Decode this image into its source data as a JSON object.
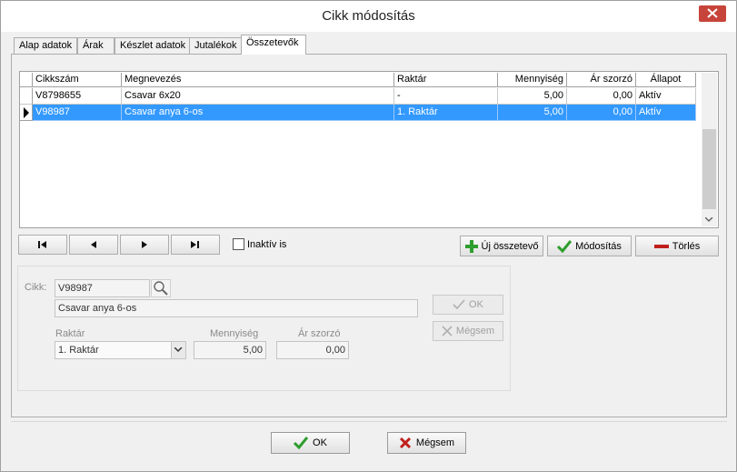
{
  "window": {
    "title": "Cikk módosítás"
  },
  "tabs": [
    {
      "label": "Alap adatok"
    },
    {
      "label": "Árak"
    },
    {
      "label": "Készlet adatok"
    },
    {
      "label": "Jutalékok"
    },
    {
      "label": "Összetevők",
      "active": true
    }
  ],
  "grid": {
    "columns": [
      "Cikkszám",
      "Megnevezés",
      "Raktár",
      "Mennyiség",
      "Ár szorzó",
      "Állapot"
    ],
    "rows": [
      {
        "cikkszam": "V8798655",
        "megnevezes": "Csavar 6x20",
        "raktar": "-",
        "mennyiseg": "5,00",
        "ar_szorzo": "0,00",
        "allapot": "Aktív"
      },
      {
        "cikkszam": "V98987",
        "megnevezes": "Csavar anya 6-os",
        "raktar": "1. Raktár",
        "mennyiseg": "5,00",
        "ar_szorzo": "0,00",
        "allapot": "Aktív",
        "selected": true
      }
    ]
  },
  "navigator": {
    "inactive_label": "Inaktív is"
  },
  "actions": {
    "new_label": "Új összetevő",
    "modify_label": "Módosítás",
    "delete_label": "Törlés"
  },
  "detail": {
    "cikk_label": "Cikk:",
    "cikk_code": "V98987",
    "cikk_name": "Csavar anya 6-os",
    "raktar_label": "Raktár",
    "raktar_value": "1. Raktár",
    "mennyiseg_label": "Mennyiség",
    "mennyiseg_value": "5,00",
    "ar_szorzo_label": "Ár szorzó",
    "ar_szorzo_value": "0,00",
    "ok_label": "OK",
    "cancel_label": "Mégsem"
  },
  "footer": {
    "ok_label": "OK",
    "cancel_label": "Mégsem"
  },
  "colors": {
    "selection": "#3399ff",
    "close": "#c7443a",
    "accent_green": "#2e9e2e",
    "accent_red": "#c0201c"
  }
}
